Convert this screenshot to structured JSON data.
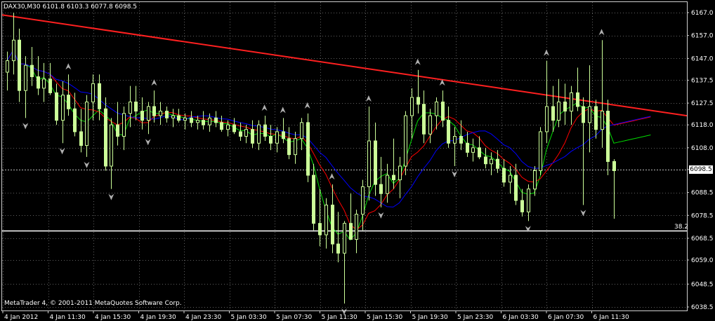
{
  "window": {
    "symbol_info": "DAX30,M30  6101.8 6103.3 6077.8 6098.5",
    "copyright": "MetaTrader 4, © 2001-2011 MetaQuotes Software Corp.",
    "current_price_tag": "6098.5",
    "fib_label": "38.2"
  },
  "colors": {
    "background": "#000000",
    "candle": "#ccff99",
    "grid": "#a0a0a0",
    "trendline": "#ff2020",
    "ma_fast": "#00dd00",
    "ma_mid": "#ff0000",
    "ma_slow": "#0000ff",
    "fractal": "#b0b0b0"
  },
  "chart_data": {
    "type": "candlestick",
    "timeframe": "M30",
    "instrument": "DAX30",
    "ohlc_current": {
      "open": 6101.8,
      "high": 6103.3,
      "low": 6077.8,
      "close": 6098.5
    },
    "ylim": [
      6038.5,
      6167.0
    ],
    "y_ticks": [
      "6167.0",
      "6157.0",
      "6147.0",
      "6137.5",
      "6127.5",
      "6118.0",
      "6108.0",
      "6098.5",
      "6088.5",
      "6078.5",
      "6068.5",
      "6059.0",
      "6048.5",
      "6038.5"
    ],
    "x_ticks": [
      "4 Jan 2012",
      "4 Jan 11:30",
      "4 Jan 15:30",
      "4 Jan 19:30",
      "4 Jan 23:30",
      "5 Jan 03:30",
      "5 Jan 07:30",
      "5 Jan 11:30",
      "5 Jan 15:30",
      "5 Jan 19:30",
      "5 Jan 23:30",
      "6 Jan 03:30",
      "6 Jan 07:30",
      "6 Jan 11:30"
    ],
    "horizontal_lines": [
      {
        "price": 6098.5,
        "style": "dashed",
        "label": "6098.5"
      },
      {
        "price": 6072.0,
        "style": "solid",
        "label": "38.2"
      }
    ],
    "trendline": {
      "from": {
        "time": "4 Jan 2012",
        "price": 6166.0
      },
      "to": {
        "time": "6 Jan 16:00",
        "price": 6122.0
      }
    },
    "candles": [
      [
        6141,
        6150,
        6133,
        6146
      ],
      [
        6146,
        6167,
        6140,
        6155
      ],
      [
        6155,
        6160,
        6128,
        6133
      ],
      [
        6133,
        6148,
        6121,
        6144
      ],
      [
        6144,
        6152,
        6135,
        6139
      ],
      [
        6139,
        6148,
        6131,
        6134
      ],
      [
        6134,
        6145,
        6128,
        6138
      ],
      [
        6138,
        6145,
        6131,
        6132
      ],
      [
        6132,
        6136,
        6118,
        6120
      ],
      [
        6120,
        6137,
        6110,
        6131
      ],
      [
        6131,
        6140,
        6122,
        6125
      ],
      [
        6125,
        6132,
        6113,
        6115
      ],
      [
        6115,
        6125,
        6106,
        6109
      ],
      [
        6109,
        6131,
        6104,
        6128
      ],
      [
        6128,
        6140,
        6120,
        6136
      ],
      [
        6136,
        6140,
        6120,
        6125
      ],
      [
        6125,
        6130,
        6098,
        6100
      ],
      [
        6100,
        6121,
        6090,
        6118
      ],
      [
        6118,
        6128,
        6109,
        6113
      ],
      [
        6113,
        6126,
        6107,
        6123
      ],
      [
        6123,
        6135,
        6117,
        6128
      ],
      [
        6128,
        6135,
        6120,
        6124
      ],
      [
        6124,
        6130,
        6116,
        6120
      ],
      [
        6120,
        6128,
        6114,
        6126
      ],
      [
        6126,
        6133,
        6119,
        6122
      ],
      [
        6122,
        6128,
        6118,
        6124
      ],
      [
        6124,
        6126,
        6119,
        6121
      ],
      [
        6121,
        6125,
        6117,
        6122
      ],
      [
        6122,
        6125,
        6119,
        6120
      ],
      [
        6120,
        6123,
        6116,
        6121
      ],
      [
        6121,
        6124,
        6117,
        6119
      ],
      [
        6119,
        6122,
        6116,
        6120
      ],
      [
        6120,
        6124,
        6116,
        6118
      ],
      [
        6118,
        6123,
        6115,
        6121
      ],
      [
        6121,
        6124,
        6117,
        6119
      ],
      [
        6119,
        6122,
        6115,
        6116
      ],
      [
        6116,
        6120,
        6113,
        6118
      ],
      [
        6118,
        6121,
        6114,
        6115
      ],
      [
        6115,
        6119,
        6111,
        6113
      ],
      [
        6113,
        6118,
        6110,
        6116
      ],
      [
        6116,
        6120,
        6108,
        6110
      ],
      [
        6110,
        6120,
        6107,
        6118
      ],
      [
        6118,
        6122,
        6111,
        6113
      ],
      [
        6113,
        6118,
        6107,
        6110
      ],
      [
        6110,
        6117,
        6106,
        6115
      ],
      [
        6115,
        6121,
        6110,
        6112
      ],
      [
        6112,
        6117,
        6103,
        6105
      ],
      [
        6105,
        6115,
        6101,
        6112
      ],
      [
        6112,
        6121,
        6107,
        6119
      ],
      [
        6119,
        6123,
        6093,
        6096
      ],
      [
        6096,
        6101,
        6072,
        6075
      ],
      [
        6075,
        6090,
        6065,
        6070
      ],
      [
        6070,
        6086,
        6064,
        6083
      ],
      [
        6083,
        6092,
        6062,
        6066
      ],
      [
        6066,
        6080,
        6058,
        6062
      ],
      [
        6062,
        6076,
        6040,
        6075
      ],
      [
        6075,
        6088,
        6068,
        6068
      ],
      [
        6068,
        6081,
        6062,
        6079
      ],
      [
        6079,
        6094,
        6072,
        6091
      ],
      [
        6091,
        6126,
        6085,
        6111
      ],
      [
        6111,
        6119,
        6087,
        6092
      ],
      [
        6092,
        6104,
        6082,
        6088
      ],
      [
        6088,
        6101,
        6084,
        6096
      ],
      [
        6096,
        6112,
        6090,
        6094
      ],
      [
        6094,
        6104,
        6086,
        6100
      ],
      [
        6100,
        6124,
        6096,
        6122
      ],
      [
        6122,
        6134,
        6112,
        6130
      ],
      [
        6130,
        6142,
        6123,
        6127
      ],
      [
        6127,
        6133,
        6110,
        6114
      ],
      [
        6114,
        6125,
        6110,
        6122
      ],
      [
        6122,
        6130,
        6116,
        6128
      ],
      [
        6128,
        6133,
        6117,
        6120
      ],
      [
        6120,
        6126,
        6108,
        6110
      ],
      [
        6110,
        6117,
        6100,
        6113
      ],
      [
        6113,
        6120,
        6107,
        6110
      ],
      [
        6110,
        6115,
        6104,
        6106
      ],
      [
        6106,
        6112,
        6102,
        6108
      ],
      [
        6108,
        6113,
        6103,
        6104
      ],
      [
        6104,
        6108,
        6099,
        6101
      ],
      [
        6101,
        6106,
        6096,
        6103
      ],
      [
        6103,
        6107,
        6097,
        6099
      ],
      [
        6099,
        6103,
        6091,
        6093
      ],
      [
        6093,
        6100,
        6088,
        6096
      ],
      [
        6096,
        6101,
        6083,
        6085
      ],
      [
        6085,
        6090,
        6078,
        6080
      ],
      [
        6080,
        6092,
        6076,
        6090
      ],
      [
        6090,
        6100,
        6087,
        6098
      ],
      [
        6098,
        6117,
        6096,
        6115
      ],
      [
        6115,
        6146,
        6110,
        6126
      ],
      [
        6126,
        6135,
        6115,
        6120
      ],
      [
        6120,
        6138,
        6117,
        6128
      ],
      [
        6128,
        6136,
        6118,
        6124
      ],
      [
        6124,
        6135,
        6118,
        6132
      ],
      [
        6132,
        6143,
        6124,
        6126
      ],
      [
        6126,
        6130,
        6083,
        6119
      ],
      [
        6119,
        6144,
        6106,
        6126
      ],
      [
        6126,
        6129,
        6112,
        6116
      ],
      [
        6116,
        6155,
        6108,
        6124
      ],
      [
        6124,
        6129,
        6096,
        6102
      ],
      [
        6102,
        6103,
        6077,
        6098
      ]
    ]
  }
}
